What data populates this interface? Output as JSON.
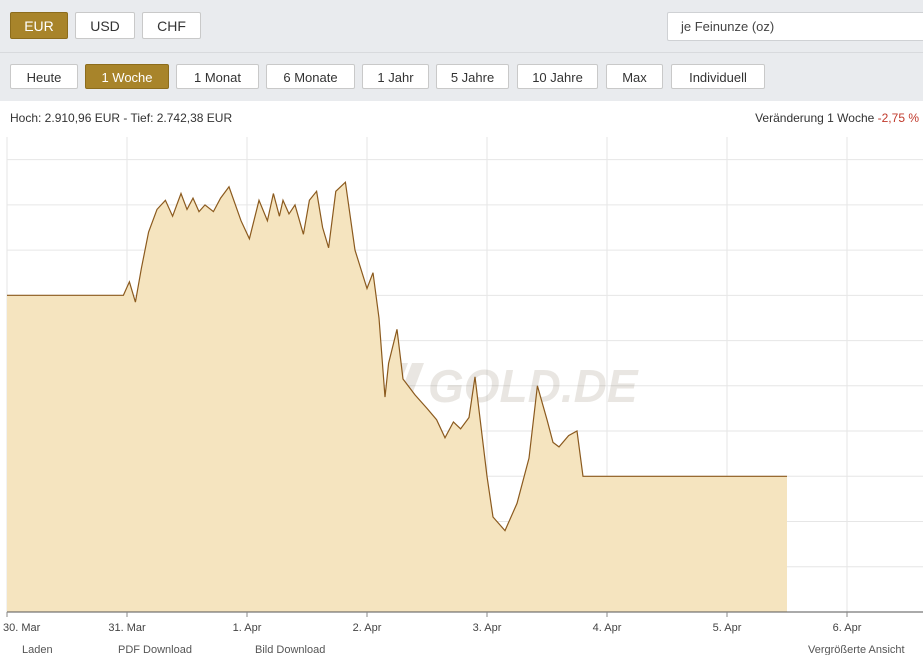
{
  "currencies": [
    {
      "label": "EUR",
      "active": true
    },
    {
      "label": "USD",
      "active": false
    },
    {
      "label": "CHF",
      "active": false
    }
  ],
  "unit_select": {
    "value": "je Feinunze (oz)"
  },
  "ranges": [
    {
      "label": "Heute",
      "active": false
    },
    {
      "label": "1 Woche",
      "active": true
    },
    {
      "label": "1 Monat",
      "active": false
    },
    {
      "label": "6 Monate",
      "active": false
    },
    {
      "label": "1 Jahr",
      "active": false
    },
    {
      "label": "5 Jahre",
      "active": false
    },
    {
      "label": "10 Jahre",
      "active": false
    },
    {
      "label": "Max",
      "active": false
    },
    {
      "label": "Individuell",
      "active": false
    }
  ],
  "stats": {
    "high_low": "Hoch: 2.910,96 EUR - Tief: 2.742,38 EUR",
    "change_label": "Veränderung 1 Woche",
    "change_value": "-2,75 %"
  },
  "watermark": "GOLD.DE",
  "colors": {
    "accent": "#a8842a",
    "line": "#8b5a1e",
    "fill": "#f5e4bf",
    "negative": "#c0392b"
  },
  "chart_data": {
    "type": "area",
    "title": "",
    "xlabel": "",
    "ylabel": "",
    "x_ticks": [
      "30. Mar",
      "31. Mar",
      "1. Apr",
      "2. Apr",
      "3. Apr",
      "4. Apr",
      "5. Apr",
      "6. Apr"
    ],
    "ylim": [
      2720,
      2930
    ],
    "grid": true,
    "series": [
      {
        "x": [
          0,
          0.97,
          1.02,
          1.07,
          1.12,
          1.18,
          1.25,
          1.32,
          1.38,
          1.45,
          1.5,
          1.55,
          1.6,
          1.65,
          1.72,
          1.78,
          1.85,
          1.95,
          2.02,
          2.1,
          2.17,
          2.22,
          2.27,
          2.3,
          2.35,
          2.4,
          2.47,
          2.52,
          2.58,
          2.63,
          2.68,
          2.74,
          2.82,
          2.9,
          3.0,
          3.05,
          3.1,
          3.15,
          3.18,
          3.25,
          3.3,
          3.4,
          3.5,
          3.58,
          3.65,
          3.72,
          3.78,
          3.85,
          3.9,
          4.0,
          4.05,
          4.15,
          4.25,
          4.35,
          4.42,
          4.5,
          4.55,
          4.6,
          4.68,
          4.75,
          4.8,
          4.85,
          4.9,
          5.0,
          6.5
        ],
        "values": [
          2860,
          2860,
          2866,
          2857,
          2872,
          2888,
          2898,
          2902,
          2895,
          2905,
          2898,
          2903,
          2897,
          2900,
          2897,
          2903,
          2908,
          2893,
          2885,
          2902,
          2893,
          2905,
          2895,
          2902,
          2896,
          2900,
          2887,
          2902,
          2906,
          2890,
          2881,
          2906,
          2910,
          2880,
          2863,
          2870,
          2850,
          2815,
          2830,
          2845,
          2823,
          2816,
          2810,
          2805,
          2797,
          2804,
          2801,
          2806,
          2824,
          2780,
          2762,
          2756,
          2768,
          2788,
          2820,
          2805,
          2795,
          2793,
          2798,
          2800,
          2780,
          2780,
          2780,
          2780,
          2780
        ]
      }
    ]
  },
  "bottom_links": [
    "Laden",
    "PDF Download",
    "Bild Download",
    "Vergrößerte Ansicht"
  ]
}
